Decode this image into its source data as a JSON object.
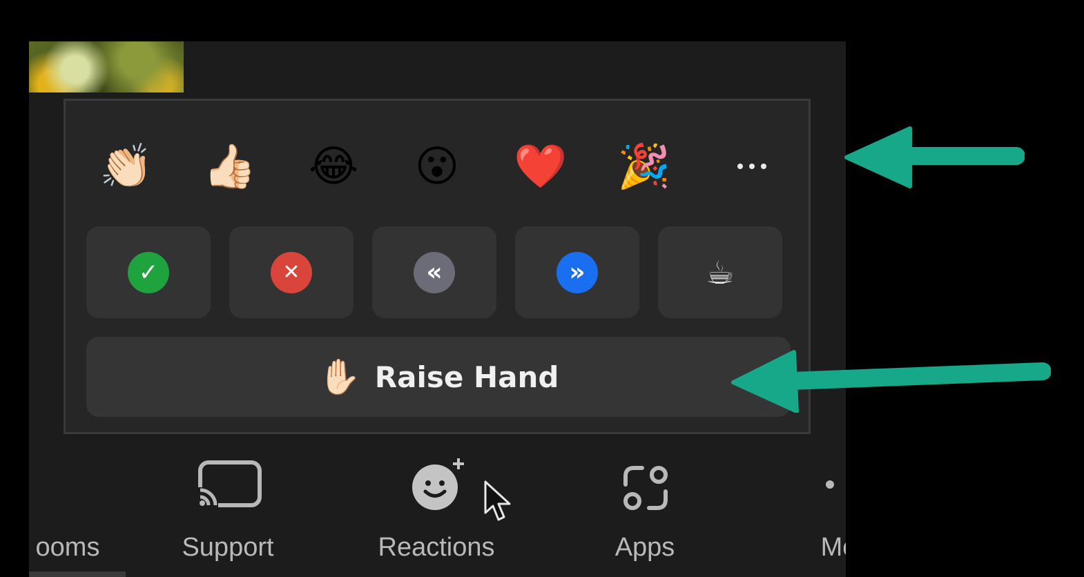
{
  "reactions": {
    "emojis": [
      {
        "name": "clapping-hands",
        "glyph": "👏🏻"
      },
      {
        "name": "thumbs-up",
        "glyph": "👍🏻"
      },
      {
        "name": "tears-of-joy",
        "glyph": "😂"
      },
      {
        "name": "open-mouth",
        "glyph": "😮"
      },
      {
        "name": "red-heart",
        "glyph": "❤️"
      },
      {
        "name": "party-popper",
        "glyph": "🎉"
      }
    ],
    "more_icon": "more-ellipsis-icon",
    "quick_buttons": [
      {
        "name": "yes",
        "glyph": "✓",
        "color": "#1fa33f"
      },
      {
        "name": "no",
        "glyph": "✕",
        "color": "#d9453a"
      },
      {
        "name": "slow-down",
        "glyph": "«",
        "color": "#6c6c78"
      },
      {
        "name": "speed-up",
        "glyph": "»",
        "color": "#1a6ff0"
      },
      {
        "name": "coffee",
        "glyph": "☕",
        "color": "#e9e9e9"
      }
    ],
    "raise_hand": {
      "glyph": "✋🏻",
      "label": "Raise Hand"
    }
  },
  "toolbar": {
    "items": [
      {
        "label": "ooms"
      },
      {
        "label": "Support",
        "icon": "cast-screen-icon"
      },
      {
        "label": "Reactions",
        "icon": "smiley-plus-icon"
      },
      {
        "label": "Apps",
        "icon": "apps-icon"
      },
      {
        "label": "Mo"
      }
    ]
  },
  "annotations": {
    "arrow_color": "#17a88a"
  }
}
